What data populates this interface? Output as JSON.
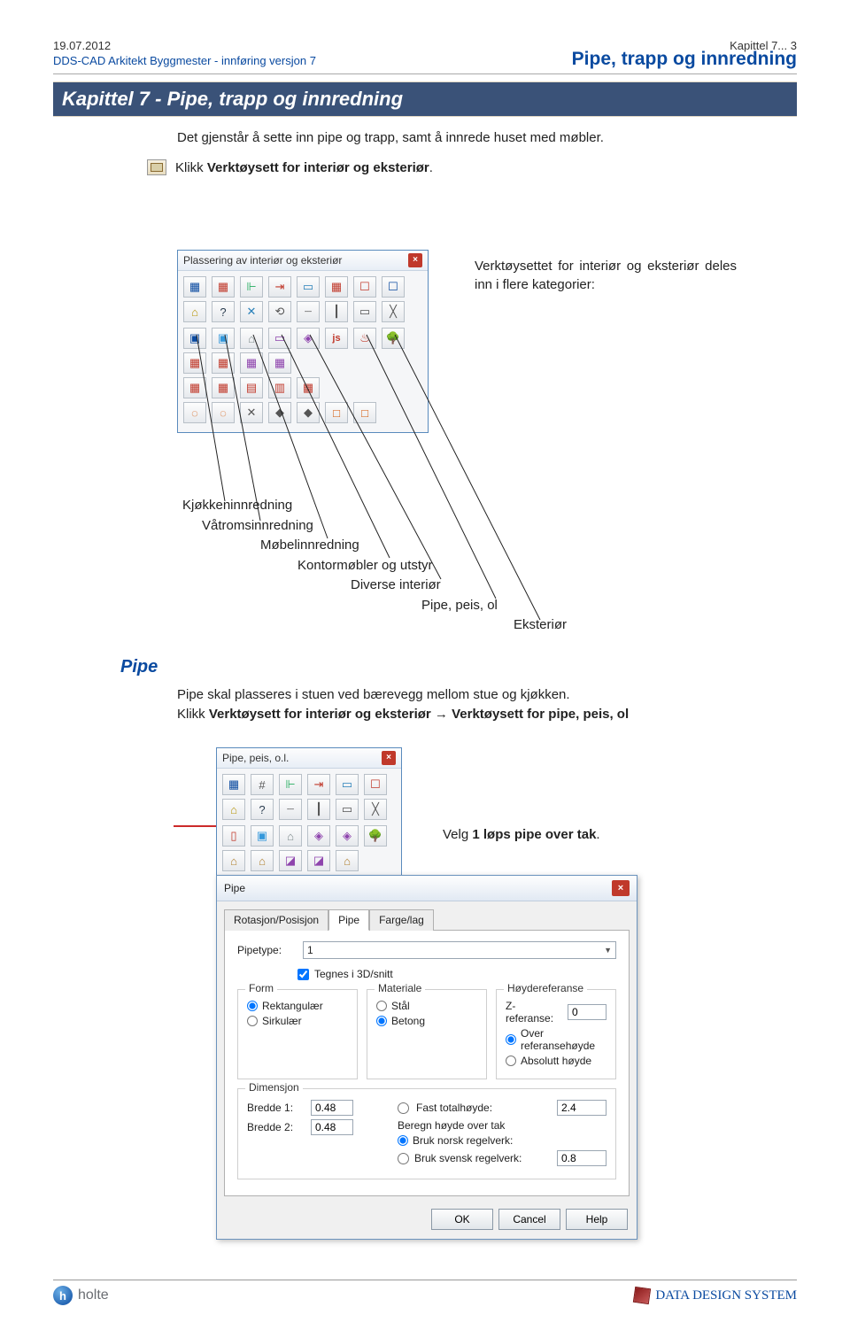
{
  "header": {
    "date": "19.07.2012",
    "pubtitle": "DDS-CAD Arkitekt Byggmester -  innføring versjon 7",
    "chapter_ref": "Kapittel 7... 3",
    "chapter_title": "Pipe, trapp og innredning"
  },
  "title_bar": "Kapittel 7  - Pipe, trapp og innredning",
  "intro": {
    "p1": "Det gjenstår å sette inn pipe og trapp, samt å innrede huset med møbler.",
    "p2_prefix": "Klikk ",
    "p2_bold": "Verktøysett for interiør og eksteriør",
    "p2_suffix": "."
  },
  "panel1": {
    "title": "Plassering av interiør og eksteriør"
  },
  "annot1": "Verktøysettet for interiør og eksteriør deles inn i flere kategorier:",
  "categories": {
    "c1": "Kjøkkeninnredning",
    "c2": "Våtromsinnredning",
    "c3": "Møbelinnredning",
    "c4": "Kontormøbler og utstyr",
    "c5": "Diverse interiør",
    "c6": "Pipe, peis, ol",
    "c7": "Eksteriør"
  },
  "section_pipe": "Pipe",
  "pipe_body": {
    "line1": "Pipe skal plasseres i stuen ved bærevegg mellom stue og kjøkken.",
    "line2a": "Klikk ",
    "line2b": "Verktøysett for interiør og eksteriør → Verktøysett for pipe, peis, ol"
  },
  "panel2": {
    "title": "Pipe, peis, o.l."
  },
  "velg": {
    "pre": "Velg ",
    "bold": "1 løps pipe over tak",
    "post": "."
  },
  "dialog": {
    "title": "Pipe",
    "tabs": {
      "t1": "Rotasjon/Posisjon",
      "t2": "Pipe",
      "t3": "Farge/lag"
    },
    "fields": {
      "pipetype_label": "Pipetype:",
      "pipetype_value": "1",
      "chk_tegnes": "Tegnes i 3D/snitt"
    },
    "group_form": {
      "title": "Form",
      "r1": "Rektangulær",
      "r2": "Sirkulær"
    },
    "group_mat": {
      "title": "Materiale",
      "r1": "Stål",
      "r2": "Betong"
    },
    "group_href": {
      "title": "Høydereferanse",
      "zref_label": "Z-referanse:",
      "zref_val": "0",
      "over": "Over referansehøyde",
      "abs": "Absolutt høyde"
    },
    "group_dim": {
      "title": "Dimensjon",
      "b1_label": "Bredde 1:",
      "b1_val": "0.48",
      "b2_label": "Bredde 2:",
      "b2_val": "0.48",
      "fast_label": "Fast totalhøyde:",
      "fast_val": "2.4",
      "beregn_title": "Beregn høyde over tak",
      "norsk": "Bruk norsk regelverk:",
      "svensk": "Bruk svensk regelverk:",
      "svensk_val": "0.8"
    },
    "buttons": {
      "ok": "OK",
      "cancel": "Cancel",
      "help": "Help"
    }
  },
  "footer": {
    "holte": "holte",
    "dds": "DATA DESIGN SYSTEM"
  }
}
